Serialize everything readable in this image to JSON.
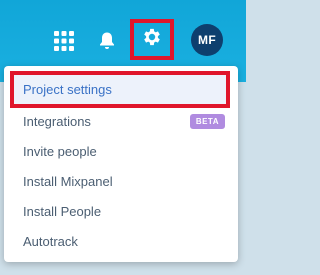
{
  "topbar": {
    "icons": {
      "apps": "apps-grid-icon",
      "notifications": "bell-icon",
      "settings": "gear-icon"
    },
    "avatar_initials": "MF",
    "colors": {
      "bar": "#14aadb",
      "avatar": "#0e3f6e",
      "highlight_border": "#e0162b"
    }
  },
  "menu": {
    "items": [
      {
        "label": "Project settings",
        "active": true
      },
      {
        "label": "Integrations",
        "badge": "BETA"
      },
      {
        "label": "Invite people"
      },
      {
        "label": "Install Mixpanel"
      },
      {
        "label": "Install People"
      },
      {
        "label": "Autotrack"
      }
    ],
    "colors": {
      "text": "#4b5e72",
      "active_text": "#3a72c6",
      "badge_bg": "#b08be0"
    }
  }
}
